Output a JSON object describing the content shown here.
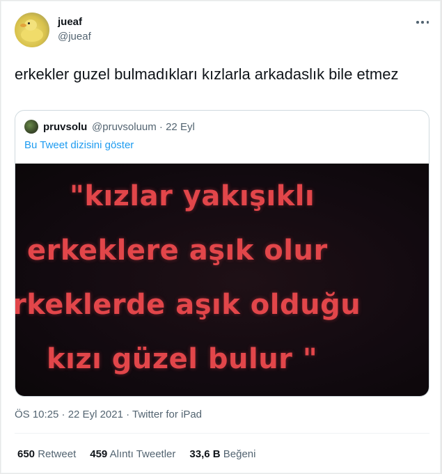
{
  "author": {
    "display_name": "jueaf",
    "handle": "@jueaf"
  },
  "tweet": {
    "text": "erkekler guzel bulmadıkları kızlarla arkadaslık bile etmez"
  },
  "quoted_tweet": {
    "display_name": "pruvsolu",
    "handle_and_date": "@pruvsoluum · 22 Eyl",
    "show_thread": "Bu Tweet dizisini göster",
    "media_text": {
      "line1": "\"kızlar yakışıklı",
      "line2": "erkeklere aşık olur",
      "line3": "rkeklerde aşık olduğu",
      "line4": "kızı güzel bulur \""
    }
  },
  "meta": {
    "timestamp": "ÖS 10:25 · 22 Eyl 2021 · Twitter for iPad"
  },
  "stats": {
    "retweets_count": "650",
    "retweets_label": "Retweet",
    "quotes_count": "459",
    "quotes_label": "Alıntı Tweetler",
    "likes_count": "33,6 B",
    "likes_label": "Beğeni"
  },
  "icons": {
    "more": "more-horizontal-icon"
  },
  "colors": {
    "accent": "#1d9bf0",
    "secondary_text": "#536471",
    "media_text": "#e2464a"
  }
}
